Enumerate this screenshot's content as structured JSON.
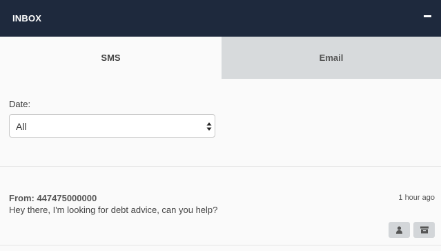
{
  "header": {
    "title": "INBOX",
    "minimize_icon": "minus-icon"
  },
  "tabs": [
    {
      "label": "SMS",
      "active": true
    },
    {
      "label": "Email",
      "active": false
    }
  ],
  "filter": {
    "date_label": "Date:",
    "date_value": "All",
    "date_options": [
      "All"
    ]
  },
  "messages": [
    {
      "from": "From: 447475000000",
      "time": "1 hour ago",
      "body": "Hey there, I'm looking for debt advice, can you help?",
      "actions": [
        {
          "icon": "user-icon"
        },
        {
          "icon": "archive-icon"
        }
      ]
    }
  ],
  "colors": {
    "header_bg": "#1e293d",
    "inactive_tab_bg": "#d7dadc",
    "button_bg": "#d3d6d9"
  }
}
